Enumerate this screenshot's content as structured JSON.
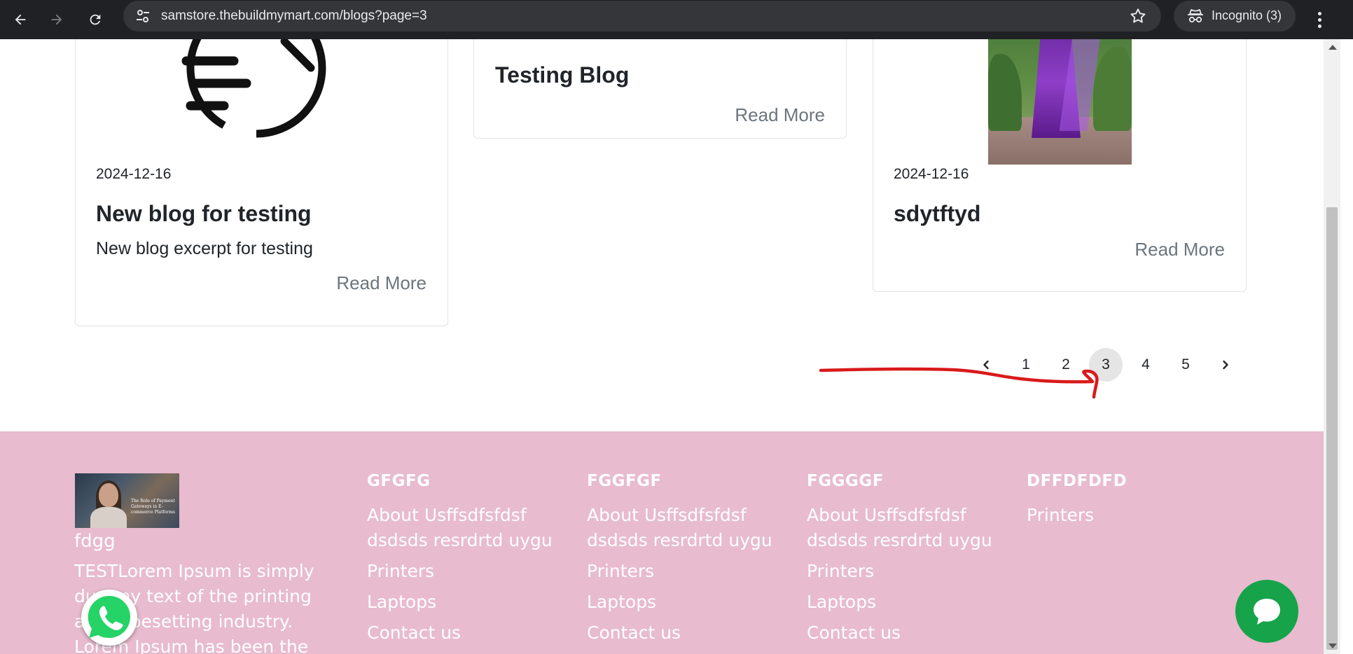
{
  "browser": {
    "url": "samstore.thebuildmymart.com/blogs?page=3",
    "incognito_label": "Incognito (3)"
  },
  "blog": {
    "cards": [
      {
        "date": "2024-12-16",
        "title": "New blog for testing",
        "excerpt": "New blog excerpt for testing",
        "read_more": "Read More"
      },
      {
        "title": "Testing Blog",
        "read_more": "Read More"
      },
      {
        "date": "2024-12-16",
        "title": "sdytftyd",
        "read_more": "Read More"
      }
    ]
  },
  "pagination": {
    "pages": [
      "1",
      "2",
      "3",
      "4",
      "5"
    ],
    "active": "3"
  },
  "footer": {
    "brand": "fdgg",
    "logo_caption": "The Role of Payment Gateways in E-commerce Platforms",
    "description": "TESTLorem Ipsum is simply dummy text of the printing and typesetting industry. Lorem Ipsum has been the industrys",
    "columns": [
      {
        "title": "GFGFG",
        "links": [
          "About Usffsdfsfdsf dsdsds resrdrtd uygu",
          "Printers",
          "Laptops",
          "Contact us"
        ]
      },
      {
        "title": "FGGFGF",
        "links": [
          "About Usffsdfsfdsf dsdsds resrdrtd uygu",
          "Printers",
          "Laptops",
          "Contact us"
        ]
      },
      {
        "title": "FGGGGF",
        "links": [
          "About Usffsdfsfdsf dsdsds resrdrtd uygu",
          "Printers",
          "Laptops",
          "Contact us"
        ]
      },
      {
        "title": "DFFDFDFD",
        "links": [
          "Printers"
        ]
      }
    ]
  },
  "colors": {
    "footer_bg": "#e8bbcf",
    "chat_button": "#16a34a",
    "whatsapp": "#25d366",
    "annotation": "#d91a1a"
  }
}
